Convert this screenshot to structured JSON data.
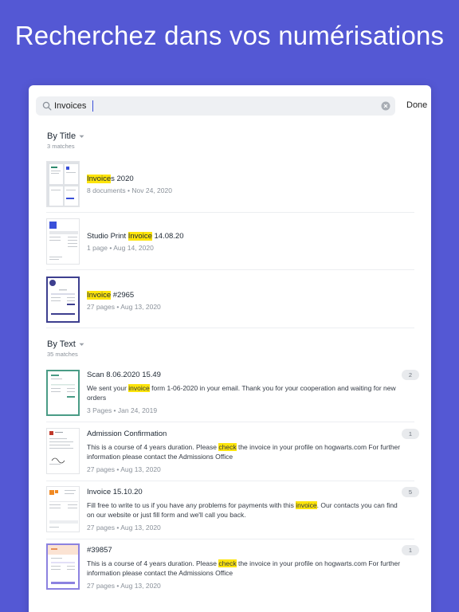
{
  "headline": "Recherchez dans vos numérisations",
  "search": {
    "value": "Invoices",
    "done_label": "Done"
  },
  "colors": {
    "background": "#5458d4",
    "highlight": "#fde40b",
    "accent_blue": "#3a50d9"
  },
  "sections": [
    {
      "title": "By Title",
      "matches": "3 matches",
      "items": [
        {
          "hl": "Invoice",
          "pre": "",
          "post": "s 2020",
          "meta": "8 documents • Nov 24, 2020"
        },
        {
          "pre": "Studio Print ",
          "hl": "Invoice",
          "post": " 14.08.20",
          "meta": "1 page • Aug 14, 2020"
        },
        {
          "pre": "",
          "hl": "Invoice",
          "post": " #2965",
          "meta": "27 pages • Aug 13, 2020"
        }
      ]
    },
    {
      "title": "By Text",
      "matches": "35 matches",
      "items": [
        {
          "title": "Scan 8.06.2020 15.49",
          "snip_pre": "We sent your ",
          "snip_hl": "invoice",
          "snip_post": " form 1-06-2020 in your email. Thank you for your cooperation and waiting for new orders",
          "meta": "3 Pages • Jan 24, 2019",
          "badge": "2"
        },
        {
          "title": "Admission Confirmation",
          "snip_pre": "This is a course of 4 years duration. Please ",
          "snip_hl": "check",
          "snip_post": " the invoice in your profile on hogwarts.com For further information please contact the Admissions Office",
          "meta": "27 pages • Aug 13, 2020",
          "badge": "1"
        },
        {
          "title": "Invoice 15.10.20",
          "snip_pre": "Fill free to write to us if you have any problems for payments with this ",
          "snip_hl": "invoice",
          "snip_post": ". Our contacts you can find on our website or just fill form and we'll call you back.",
          "meta": "27 pages • Aug 13, 2020",
          "badge": "5"
        },
        {
          "title": "#39857",
          "snip_pre": "This is a course of 4 years duration. Please ",
          "snip_hl": "check",
          "snip_post": " the invoice in your profile on hogwarts.com For further information please contact the Admissions Office",
          "meta": "27 pages • Aug 13, 2020",
          "badge": "1"
        }
      ]
    }
  ]
}
